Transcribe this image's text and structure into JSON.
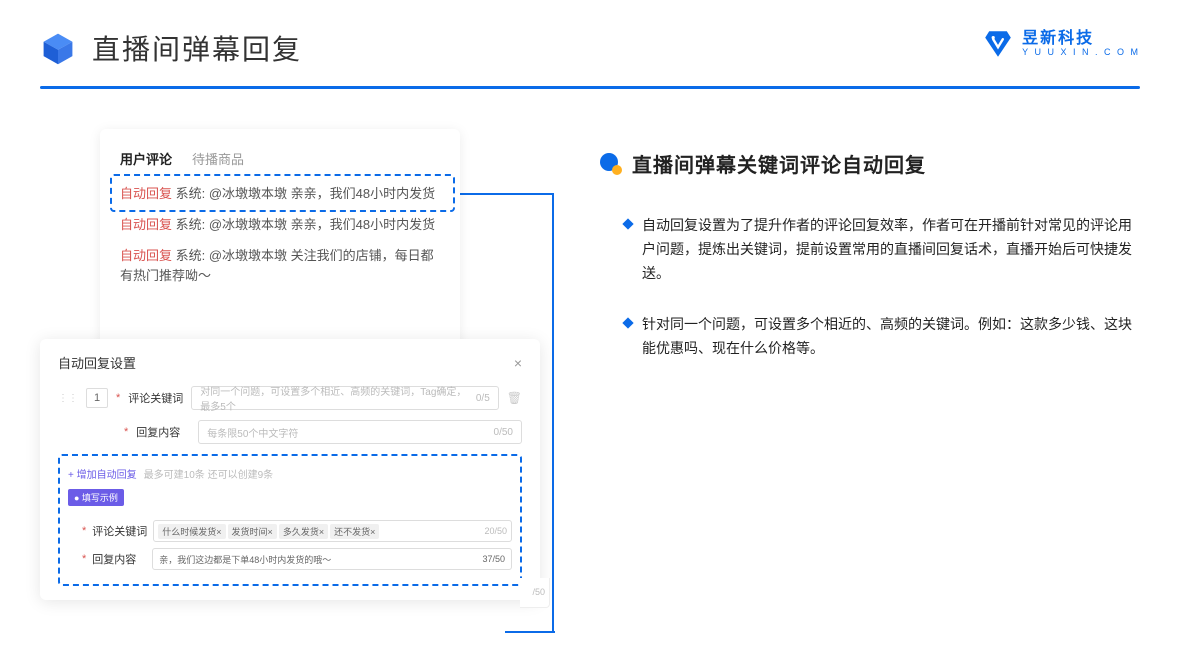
{
  "header": {
    "title": "直播间弹幕回复",
    "brand_name": "昱新科技",
    "brand_url": "Y U U X I N . C O M"
  },
  "card1": {
    "tab_active": "用户评论",
    "tab_inactive": "待播商品",
    "c1_badge": "自动回复",
    "c1_text": " 系统: @冰墩墩本墩 亲亲，我们48小时内发货",
    "c2_badge": "自动回复",
    "c2_text": " 系统: @冰墩墩本墩 亲亲，我们48小时内发货",
    "c3_badge": "自动回复",
    "c3_text": " 系统: @冰墩墩本墩 关注我们的店铺，每日都有热门推荐呦～"
  },
  "card2": {
    "title": "自动回复设置",
    "row_num": "1",
    "kw_label": "评论关键词",
    "kw_placeholder": "对同一个问题，可设置多个相近、高频的关键词，Tag确定，最多5个",
    "kw_count": "0/5",
    "content_label": "回复内容",
    "content_placeholder": "每条限50个中文字符",
    "content_count": "0/50",
    "add_link": "+ 增加自动回复",
    "add_hint": "最多可建10条 还可以创建9条",
    "example_badge": "● 填写示例",
    "sub_kw_label": "评论关键词",
    "tags": [
      "什么时候发货×",
      "发货时间×",
      "多久发货×",
      "还不发货×"
    ],
    "tag_count": "20/50",
    "sub_content_label": "回复内容",
    "sub_content_text": "亲，我们这边都是下单48小时内发货的哦～",
    "sub_content_count": "37/50",
    "clip_count": "/50"
  },
  "right": {
    "section_title": "直播间弹幕关键词评论自动回复",
    "p1": "自动回复设置为了提升作者的评论回复效率，作者可在开播前针对常见的评论用户问题，提炼出关键词，提前设置常用的直播间回复话术，直播开始后可快捷发送。",
    "p2": "针对同一个问题，可设置多个相近的、高频的关键词。例如：这款多少钱、这块能优惠吗、现在什么价格等。"
  }
}
